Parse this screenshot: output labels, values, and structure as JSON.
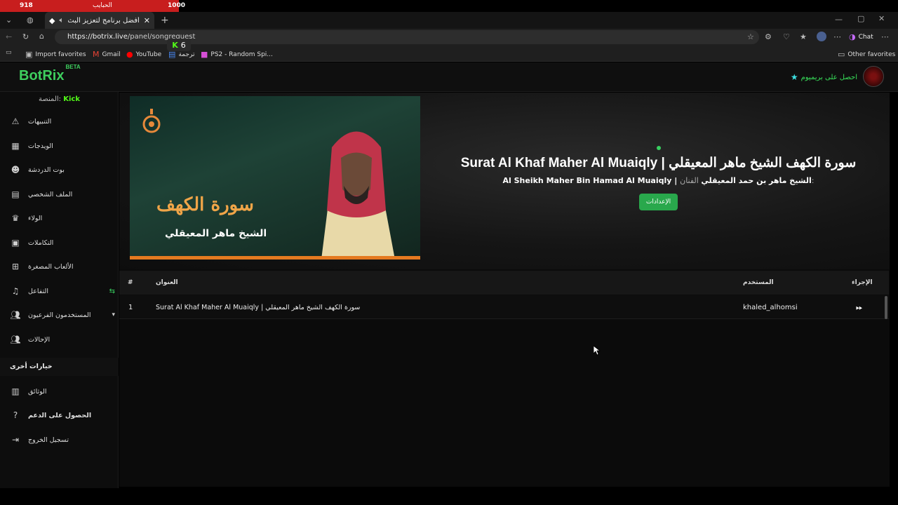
{
  "overlay": {
    "left_value": "918",
    "center_label": "الحبايب",
    "right_value": "1000",
    "progress": 0.918
  },
  "browser": {
    "tab_title": "أفضل برنامج لتعزيز البث المباشر",
    "url_host": "https://botrix.live",
    "url_path": "/panel/songrequest",
    "chat_label": "Chat",
    "favorites": [
      {
        "label": "Import favorites",
        "icon": "import-icon"
      },
      {
        "label": "Gmail",
        "icon": "gmail-icon"
      },
      {
        "label": "YouTube",
        "icon": "youtube-icon"
      },
      {
        "label": "ترجمة",
        "icon": "translate-icon"
      },
      {
        "label": "PS2 - Random Spi...",
        "icon": "ps2-icon"
      }
    ],
    "other_favorites": "Other favorites",
    "kick_badge": {
      "letter": "K",
      "count": "6"
    }
  },
  "app": {
    "logo": "BotRix",
    "logo_beta": "BETA",
    "premium_label": "احصل على بريميوم",
    "platform_label": "المنصة:",
    "platform_value": "Kick"
  },
  "sidebar": {
    "items": [
      {
        "label": "التنبيهات",
        "icon": "warning-icon"
      },
      {
        "label": "الويدجات",
        "icon": "widgets-icon"
      },
      {
        "label": "بوت الدردشة",
        "icon": "robot-icon"
      },
      {
        "label": "الملف الشخصي",
        "icon": "id-card-icon"
      },
      {
        "label": "الولاء",
        "icon": "trophy-icon"
      },
      {
        "label": "التكاملات",
        "icon": "integrations-icon"
      },
      {
        "label": "الألعاب المصغرة",
        "icon": "gamepad-icon"
      },
      {
        "label": "التفاعل",
        "icon": "music-icon"
      },
      {
        "label": "المستخدمون الفرعيون",
        "icon": "users-icon"
      },
      {
        "label": "الإحالات",
        "icon": "referrals-icon"
      }
    ],
    "other_header": "خيارات أخرى",
    "other_items": [
      {
        "label": "الوثائق",
        "icon": "docs-icon"
      },
      {
        "label": "الحصول على الدعم",
        "icon": "help-icon"
      },
      {
        "label": "تسجيل الخروج",
        "icon": "logout-icon"
      }
    ]
  },
  "now_playing": {
    "cover_title": "سورة الكهف",
    "cover_subtitle": "الشيخ ماهر المعيقلي",
    "title": "Surat Al Khaf Maher Al Muaiqly | سورة الكهف الشيخ ماهر المعيقلي",
    "artist_label": "الفنان:",
    "artist": "Al Sheikh Maher Bin Hamad Al Muaiqly | الشيخ ماهر بن حمد المعيقلي",
    "settings_button": "الإعدادات"
  },
  "queue": {
    "columns": {
      "num": "#",
      "title": "العنوان",
      "user": "المستخدم",
      "action": "الإجراء"
    },
    "rows": [
      {
        "num": "1",
        "title": "Surat Al Khaf Maher Al Muaiqly | سورة الكهف الشيخ ماهر المعيقلي",
        "user": "khaled_alhomsi"
      }
    ]
  },
  "colors": {
    "accent": "#3ecf5e",
    "kick": "#53fc18",
    "overlay_red": "#c81e1e",
    "cover_orange": "#e47a20"
  }
}
